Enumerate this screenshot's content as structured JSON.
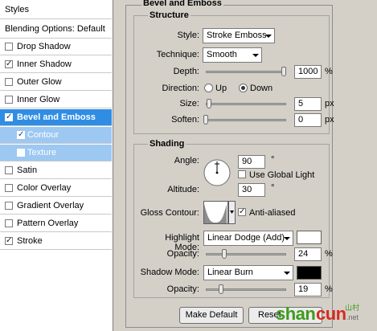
{
  "left_panel": {
    "styles_title": "Styles",
    "blending_options": "Blending Options: Default",
    "items": [
      {
        "label": "Drop Shadow",
        "checked": false
      },
      {
        "label": "Inner Shadow",
        "checked": true
      },
      {
        "label": "Outer Glow",
        "checked": false
      },
      {
        "label": "Inner Glow",
        "checked": false
      },
      {
        "label": "Bevel and Emboss",
        "checked": true
      },
      {
        "label": "Contour",
        "checked": true
      },
      {
        "label": "Texture",
        "checked": false
      },
      {
        "label": "Satin",
        "checked": false
      },
      {
        "label": "Color Overlay",
        "checked": false
      },
      {
        "label": "Gradient Overlay",
        "checked": false
      },
      {
        "label": "Pattern Overlay",
        "checked": false
      },
      {
        "label": "Stroke",
        "checked": true
      }
    ]
  },
  "bevel": {
    "title": "Bevel and Emboss",
    "structure": {
      "title": "Structure",
      "style_label": "Style:",
      "style_value": "Stroke Emboss",
      "technique_label": "Technique:",
      "technique_value": "Smooth",
      "depth_label": "Depth:",
      "depth_value": "1000",
      "depth_unit": "%",
      "direction_label": "Direction:",
      "direction_up": "Up",
      "direction_down": "Down",
      "direction_selected": "Down",
      "size_label": "Size:",
      "size_value": "5",
      "size_unit": "px",
      "soften_label": "Soften:",
      "soften_value": "0",
      "soften_unit": "px"
    },
    "shading": {
      "title": "Shading",
      "angle_label": "Angle:",
      "angle_value": "90",
      "angle_unit": "°",
      "global_light_label": "Use Global Light",
      "global_light_checked": false,
      "altitude_label": "Altitude:",
      "altitude_value": "30",
      "altitude_unit": "°",
      "gloss_contour_label": "Gloss Contour:",
      "anti_aliased_label": "Anti-aliased",
      "anti_aliased_checked": true,
      "highlight_mode_label": "Highlight Mode:",
      "highlight_mode_value": "Linear Dodge (Add)",
      "highlight_color": "#ffffff",
      "highlight_opacity_label": "Opacity:",
      "highlight_opacity_value": "24",
      "highlight_opacity_unit": "%",
      "shadow_mode_label": "Shadow Mode:",
      "shadow_mode_value": "Linear Burn",
      "shadow_color": "#000000",
      "shadow_opacity_label": "Opacity:",
      "shadow_opacity_value": "19",
      "shadow_opacity_unit": "%"
    }
  },
  "buttons": {
    "make_default": "Make Default",
    "reset_default": "Reset"
  },
  "watermark": {
    "green": "shan",
    "red": "cun",
    "tail": ".net",
    "chinese": "山村"
  }
}
